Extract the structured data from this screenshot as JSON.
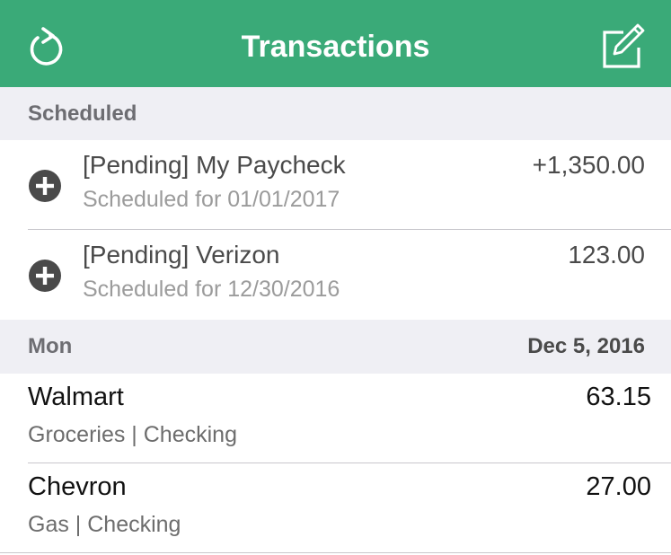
{
  "navbar": {
    "title": "Transactions",
    "left_icon": "refresh-icon",
    "right_icon": "compose-icon",
    "background_color": "#3aaa78"
  },
  "scheduled_section": {
    "header": "Scheduled",
    "items": [
      {
        "title": "[Pending] My Paycheck",
        "subtitle": "Scheduled for 01/01/2017",
        "amount": "+1,350.00",
        "icon": "add-circle-icon"
      },
      {
        "title": "[Pending] Verizon",
        "subtitle": "Scheduled for 12/30/2016",
        "amount": "123.00",
        "icon": "add-circle-icon"
      }
    ]
  },
  "day_section": {
    "day": "Mon",
    "date": "Dec 5, 2016",
    "items": [
      {
        "title": "Walmart",
        "subtitle": "Groceries | Checking",
        "amount": "63.15"
      },
      {
        "title": "Chevron",
        "subtitle": "Gas | Checking",
        "amount": "27.00"
      }
    ]
  }
}
